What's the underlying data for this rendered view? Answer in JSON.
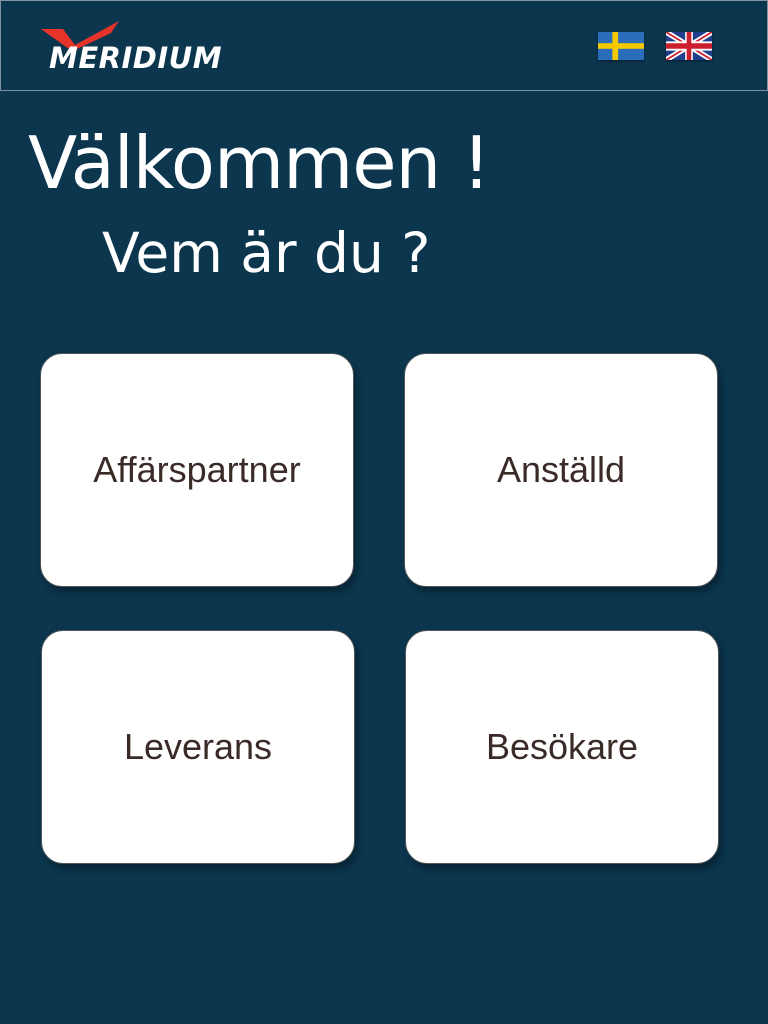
{
  "header": {
    "logo_text": "MERIDIUM",
    "languages": [
      {
        "code": "sv",
        "icon": "sweden-flag-icon"
      },
      {
        "code": "en",
        "icon": "uk-flag-icon"
      }
    ]
  },
  "main": {
    "title": "Välkommen !",
    "subtitle": "Vem är du ?",
    "options": [
      {
        "label": "Affärspartner"
      },
      {
        "label": "Anställd"
      },
      {
        "label": "Leverans"
      },
      {
        "label": "Besökare"
      }
    ]
  },
  "colors": {
    "background": "#0b364e",
    "card": "#ffffff",
    "card_text": "#3a2a28",
    "logo_accent": "#e8332a"
  }
}
